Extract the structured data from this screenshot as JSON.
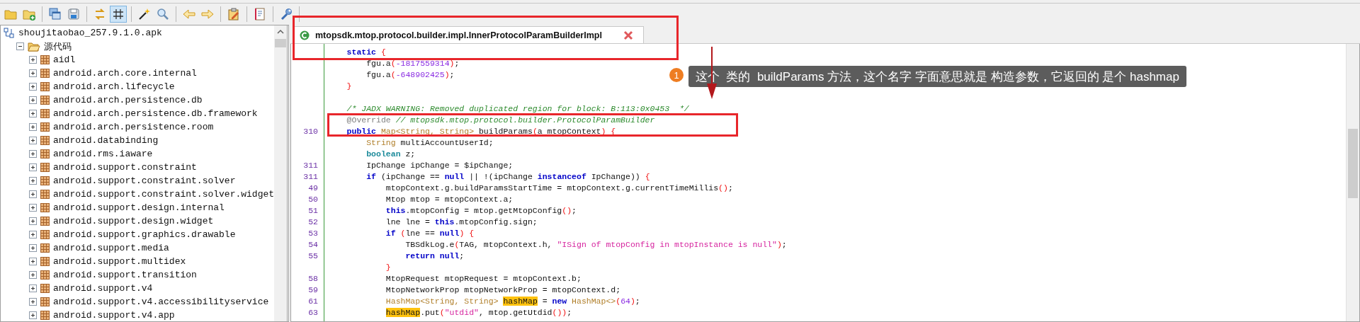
{
  "toolbar": {
    "groups": [
      [
        {
          "kind": "open",
          "pressed": false
        },
        {
          "kind": "add",
          "pressed": false
        }
      ],
      [
        {
          "kind": "copy",
          "pressed": false
        },
        {
          "kind": "save",
          "pressed": false
        }
      ],
      [
        {
          "kind": "sync",
          "pressed": false
        },
        {
          "kind": "grid",
          "pressed": true
        }
      ],
      [
        {
          "kind": "wand",
          "pressed": false
        },
        {
          "kind": "search",
          "pressed": false
        }
      ],
      [
        {
          "kind": "back",
          "pressed": false
        },
        {
          "kind": "forward",
          "pressed": false
        }
      ],
      [
        {
          "kind": "edit",
          "pressed": false
        }
      ],
      [
        {
          "kind": "log",
          "pressed": false
        }
      ],
      [
        {
          "kind": "settings",
          "pressed": false
        }
      ]
    ]
  },
  "sidebar": {
    "tree": [
      {
        "label": "shoujitaobao_257.9.1.0.apk",
        "kind": "file",
        "children": [
          {
            "label": "源代码",
            "kind": "folder",
            "expanded": true,
            "children": [
              {
                "label": "aidl",
                "kind": "package",
                "expanded": false
              },
              {
                "label": "android.arch.core.internal",
                "kind": "package",
                "expanded": false
              },
              {
                "label": "android.arch.lifecycle",
                "kind": "package",
                "expanded": false
              },
              {
                "label": "android.arch.persistence.db",
                "kind": "package",
                "expanded": false
              },
              {
                "label": "android.arch.persistence.db.framework",
                "kind": "package",
                "expanded": false
              },
              {
                "label": "android.arch.persistence.room",
                "kind": "package",
                "expanded": false
              },
              {
                "label": "android.databinding",
                "kind": "package",
                "expanded": false
              },
              {
                "label": "android.rms.iaware",
                "kind": "package",
                "expanded": false
              },
              {
                "label": "android.support.constraint",
                "kind": "package",
                "expanded": false
              },
              {
                "label": "android.support.constraint.solver",
                "kind": "package",
                "expanded": false
              },
              {
                "label": "android.support.constraint.solver.widget",
                "kind": "package",
                "expanded": false
              },
              {
                "label": "android.support.design.internal",
                "kind": "package",
                "expanded": false
              },
              {
                "label": "android.support.design.widget",
                "kind": "package",
                "expanded": false
              },
              {
                "label": "android.support.graphics.drawable",
                "kind": "package",
                "expanded": false
              },
              {
                "label": "android.support.media",
                "kind": "package",
                "expanded": false
              },
              {
                "label": "android.support.multidex",
                "kind": "package",
                "expanded": false
              },
              {
                "label": "android.support.transition",
                "kind": "package",
                "expanded": false
              },
              {
                "label": "android.support.v4",
                "kind": "package",
                "expanded": false
              },
              {
                "label": "android.support.v4.accessibilityservice",
                "kind": "package",
                "expanded": false
              },
              {
                "label": "android.support.v4.app",
                "kind": "package",
                "expanded": false
              }
            ]
          }
        ]
      }
    ]
  },
  "editor": {
    "tabs": [
      {
        "label": "mtopsdk.mtop.protocol.builder.impl.InnerProtocolParamBuilderImpl",
        "selected": true
      }
    ],
    "lines": [
      {
        "kind": "code",
        "tokens": [
          {
            "text": "    static",
            "kind": "keyword"
          },
          {
            "text": " {",
            "kind": "brace"
          }
        ]
      },
      {
        "kind": "code",
        "tokens": [
          "        fgu.a",
          {
            "text": "(",
            "kind": "brace"
          },
          {
            "text": "-1817559314",
            "kind": "number"
          },
          {
            "text": ")",
            "kind": "brace"
          },
          ";"
        ]
      },
      {
        "kind": "code",
        "tokens": [
          "        fgu.a",
          {
            "text": "(",
            "kind": "brace"
          },
          {
            "text": "-648902425",
            "kind": "number"
          },
          {
            "text": ")",
            "kind": "brace"
          },
          ";"
        ]
      },
      {
        "kind": "code",
        "tokens": [
          {
            "text": "    }",
            "kind": "brace"
          }
        ]
      },
      {
        "kind": "blank"
      },
      {
        "kind": "code",
        "tokens": [
          {
            "text": "    /* JADX WARNING: Removed duplicated region for block: B:113:0x0453  */",
            "kind": "comment"
          }
        ]
      },
      {
        "kind": "code",
        "tokens": [
          {
            "text": "    @Override ",
            "kind": "annotation"
          },
          {
            "text": "// mtopsdk.mtop.protocol.builder.ProtocolParamBuilder",
            "kind": "comment"
          }
        ]
      },
      {
        "kind": "code",
        "line_number": "310",
        "tokens": [
          {
            "text": "    public ",
            "kind": "keyword"
          },
          {
            "text": "Map<String, String>",
            "kind": "type"
          },
          " buildParams",
          {
            "text": "(",
            "kind": "brace"
          },
          "a mtopContext",
          {
            "text": ") {",
            "kind": "brace"
          }
        ]
      },
      {
        "kind": "code",
        "tokens": [
          {
            "text": "        String",
            "kind": "type"
          },
          " multiAccountUserId;"
        ]
      },
      {
        "kind": "code",
        "tokens": [
          {
            "text": "        boolean",
            "kind": "primitive"
          },
          " z;"
        ]
      },
      {
        "kind": "code",
        "line_number": "311",
        "tokens": [
          "        IpChange ipChange = $ipChange;"
        ]
      },
      {
        "kind": "code",
        "line_number": "311",
        "tokens": [
          {
            "text": "        if",
            "kind": "keyword"
          },
          " (ipChange == ",
          {
            "text": "null",
            "kind": "keyword"
          },
          " || !(ipChange ",
          {
            "text": "instanceof",
            "kind": "keyword"
          },
          " IpChange)) ",
          {
            "text": "{",
            "kind": "brace"
          }
        ]
      },
      {
        "kind": "code",
        "line_number": "49",
        "tokens": [
          "            mtopContext.g.buildParamsStartTime = mtopContext.g.currentTimeMillis",
          {
            "text": "()",
            "kind": "brace"
          },
          ";"
        ]
      },
      {
        "kind": "code",
        "line_number": "50",
        "tokens": [
          "            Mtop mtop = mtopContext.a;"
        ]
      },
      {
        "kind": "code",
        "line_number": "51",
        "tokens": [
          {
            "text": "            this",
            "kind": "keyword"
          },
          ".mtopConfig = mtop.getMtopConfig",
          {
            "text": "()",
            "kind": "brace"
          },
          ";"
        ]
      },
      {
        "kind": "code",
        "line_number": "52",
        "tokens": [
          "            lne lne = ",
          {
            "text": "this",
            "kind": "keyword"
          },
          ".mtopConfig.sign;"
        ]
      },
      {
        "kind": "code",
        "line_number": "53",
        "tokens": [
          {
            "text": "            if",
            "kind": "keyword"
          },
          {
            "text": " (",
            "kind": "brace"
          },
          "lne == ",
          {
            "text": "null",
            "kind": "keyword"
          },
          {
            "text": ") {",
            "kind": "brace"
          }
        ]
      },
      {
        "kind": "code",
        "line_number": "54",
        "tokens": [
          "                TBSdkLog.e",
          {
            "text": "(",
            "kind": "brace"
          },
          "TAG, mtopContext.h, ",
          {
            "text": "\"ISign of mtopConfig in mtopInstance is null\"",
            "kind": "string"
          },
          {
            "text": ")",
            "kind": "brace"
          },
          ";"
        ]
      },
      {
        "kind": "code",
        "line_number": "55",
        "tokens": [
          {
            "text": "                return null",
            "kind": "keyword"
          },
          ";"
        ]
      },
      {
        "kind": "code",
        "tokens": [
          {
            "text": "            }",
            "kind": "brace"
          }
        ]
      },
      {
        "kind": "code",
        "line_number": "58",
        "tokens": [
          "            MtopRequest mtopRequest = mtopContext.b;"
        ]
      },
      {
        "kind": "code",
        "line_number": "59",
        "tokens": [
          "            MtopNetworkProp mtopNetworkProp = mtopContext.d;"
        ]
      },
      {
        "kind": "code",
        "line_number": "61",
        "tokens": [
          {
            "text": "            HashMap<String, String> ",
            "kind": "type"
          },
          {
            "text": "hashMap",
            "kind": "highlight"
          },
          " = ",
          {
            "text": "new ",
            "kind": "keyword"
          },
          {
            "text": "HashMap<>",
            "kind": "type"
          },
          {
            "text": "(",
            "kind": "brace"
          },
          {
            "text": "64",
            "kind": "number"
          },
          {
            "text": ")",
            "kind": "brace"
          },
          ";"
        ]
      },
      {
        "kind": "code",
        "line_number": "63",
        "tokens": [
          {
            "text": "            hashMap",
            "kind": "highlight"
          },
          ".put",
          {
            "text": "(",
            "kind": "brace"
          },
          {
            "text": "\"utdid\"",
            "kind": "string"
          },
          ", mtop.getUtdid",
          {
            "text": "())",
            "kind": "brace"
          },
          ";"
        ]
      }
    ]
  },
  "callout": {
    "number": "1",
    "text": "这个  类的  buildParams 方法，这个名字 字面意思就是 构造参数，它返回的 是个 hashmap"
  }
}
